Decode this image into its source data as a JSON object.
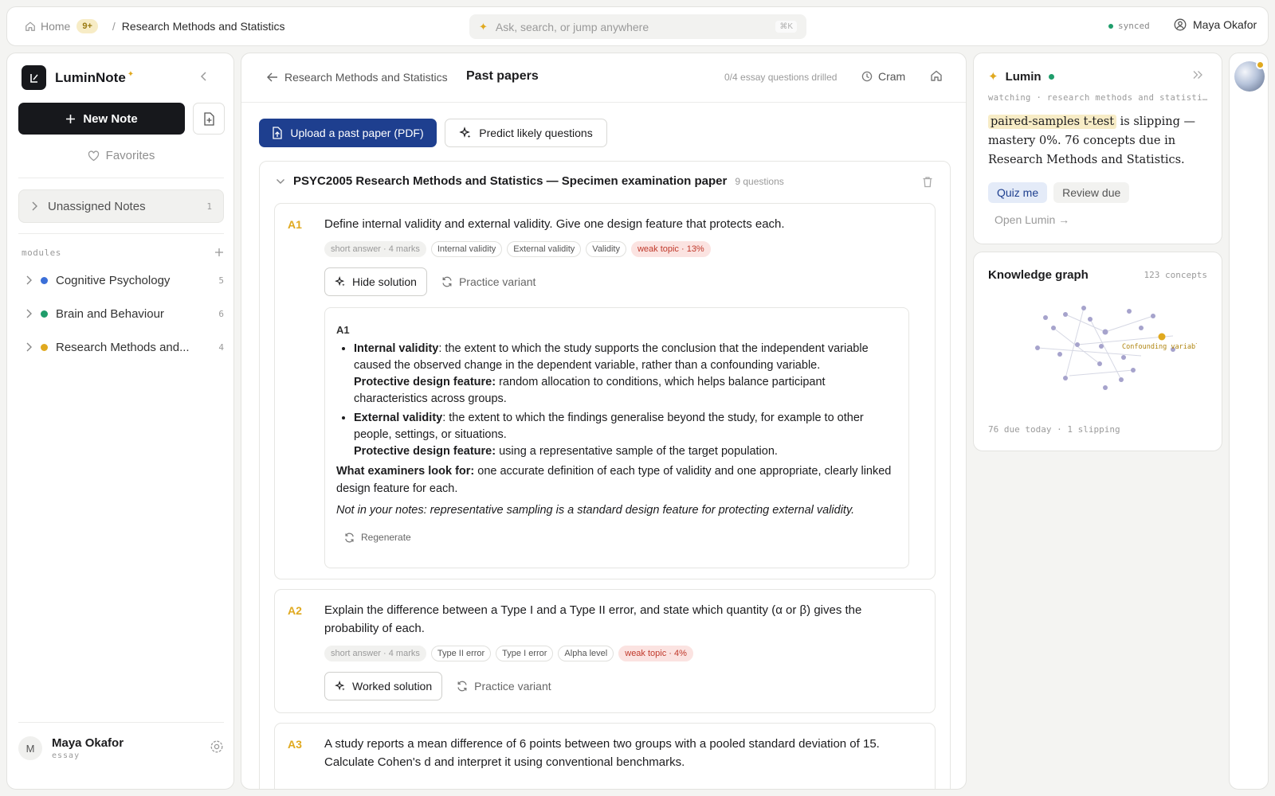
{
  "topbar": {
    "home_label": "Home",
    "notif_badge": "9+",
    "breadcrumb_sep": "/",
    "breadcrumb_current": "Research Methods and Statistics",
    "search_placeholder": "Ask, search, or jump anywhere",
    "search_shortcut": "⌘K",
    "sync_status": "synced",
    "user_name": "Maya Okafor"
  },
  "sidebar": {
    "app_name": "LuminNote",
    "new_note_label": "New Note",
    "favorites_label": "Favorites",
    "unassigned": {
      "label": "Unassigned Notes",
      "count": "1"
    },
    "modules_label": "modules",
    "modules": [
      {
        "label": "Cognitive Psychology",
        "count": "5",
        "color": "#3b6fd8"
      },
      {
        "label": "Brain and Behaviour",
        "count": "6",
        "color": "#1f9d6b"
      },
      {
        "label": "Research Methods and...",
        "count": "4",
        "color": "#e0a91f"
      }
    ],
    "user": {
      "initial": "M",
      "name": "Maya Okafor",
      "mode": "essay"
    }
  },
  "main": {
    "back_label": "Research Methods and Statistics",
    "title": "Past papers",
    "progress_text": "0/4 essay questions drilled",
    "cram_label": "Cram",
    "upload_label": "Upload a past paper (PDF)",
    "predict_label": "Predict likely questions",
    "paper": {
      "title": "PSYC2005 Research Methods and Statistics — Specimen examination paper",
      "count": "9 questions",
      "questions": [
        {
          "num": "A1",
          "text": "Define internal validity and external validity. Give one design feature that protects each.",
          "tags": [
            "short answer · 4 marks",
            "Internal validity",
            "External validity",
            "Validity",
            "weak topic · 13%"
          ],
          "solution_button": "Hide solution",
          "variant_label": "Practice variant",
          "solution": {
            "label": "A1",
            "item1_term": "Internal validity",
            "item1_text": ": the extent to which the study supports the conclusion that the independent variable caused the observed change in the dependent variable, rather than a confounding variable.",
            "item1_feature_label": "Protective design feature:",
            "item1_feature": " random allocation to conditions, which helps balance participant characteristics across groups.",
            "item2_term": "External validity",
            "item2_text": ": the extent to which the findings generalise beyond the study, for example to other people, settings, or situations.",
            "item2_feature_label": "Protective design feature:",
            "item2_feature": " using a representative sample of the target population.",
            "examiners_label": "What examiners look for:",
            "examiners_text": " one accurate definition of each type of validity and one appropriate, clearly linked design feature for each.",
            "note": "Not in your notes: representative sampling is a standard design feature for protecting external validity.",
            "regenerate_label": "Regenerate"
          }
        },
        {
          "num": "A2",
          "text": "Explain the difference between a Type I and a Type II error, and state which quantity (α or β) gives the probability of each.",
          "tags": [
            "short answer · 4 marks",
            "Type II error",
            "Type I error",
            "Alpha level",
            "weak topic · 4%"
          ],
          "solution_button": "Worked solution",
          "variant_label": "Practice variant"
        },
        {
          "num": "A3",
          "text": "A study reports a mean difference of 6 points between two groups with a pooled standard deviation of 15. Calculate Cohen's d and interpret it using conventional benchmarks."
        }
      ]
    }
  },
  "lumin": {
    "name": "Lumin",
    "watching": "watching · research methods and statistics",
    "highlight": "paired-samples t-test",
    "message": " is slipping — mastery 0%. 76 concepts due in Research Methods and Statistics.",
    "quiz_label": "Quiz me",
    "review_label": "Review due",
    "open_label": "Open Lumin →"
  },
  "knowledge_graph": {
    "title": "Knowledge graph",
    "count": "123 concepts",
    "highlight_node": "Confounding variable",
    "footer": "76 due today · 1 slipping"
  },
  "colors": {
    "accent_blue": "#1e3f8f",
    "accent_gold": "#e0a91f",
    "weak_red": "#c0392b",
    "sync_green": "#1f9d6b"
  }
}
